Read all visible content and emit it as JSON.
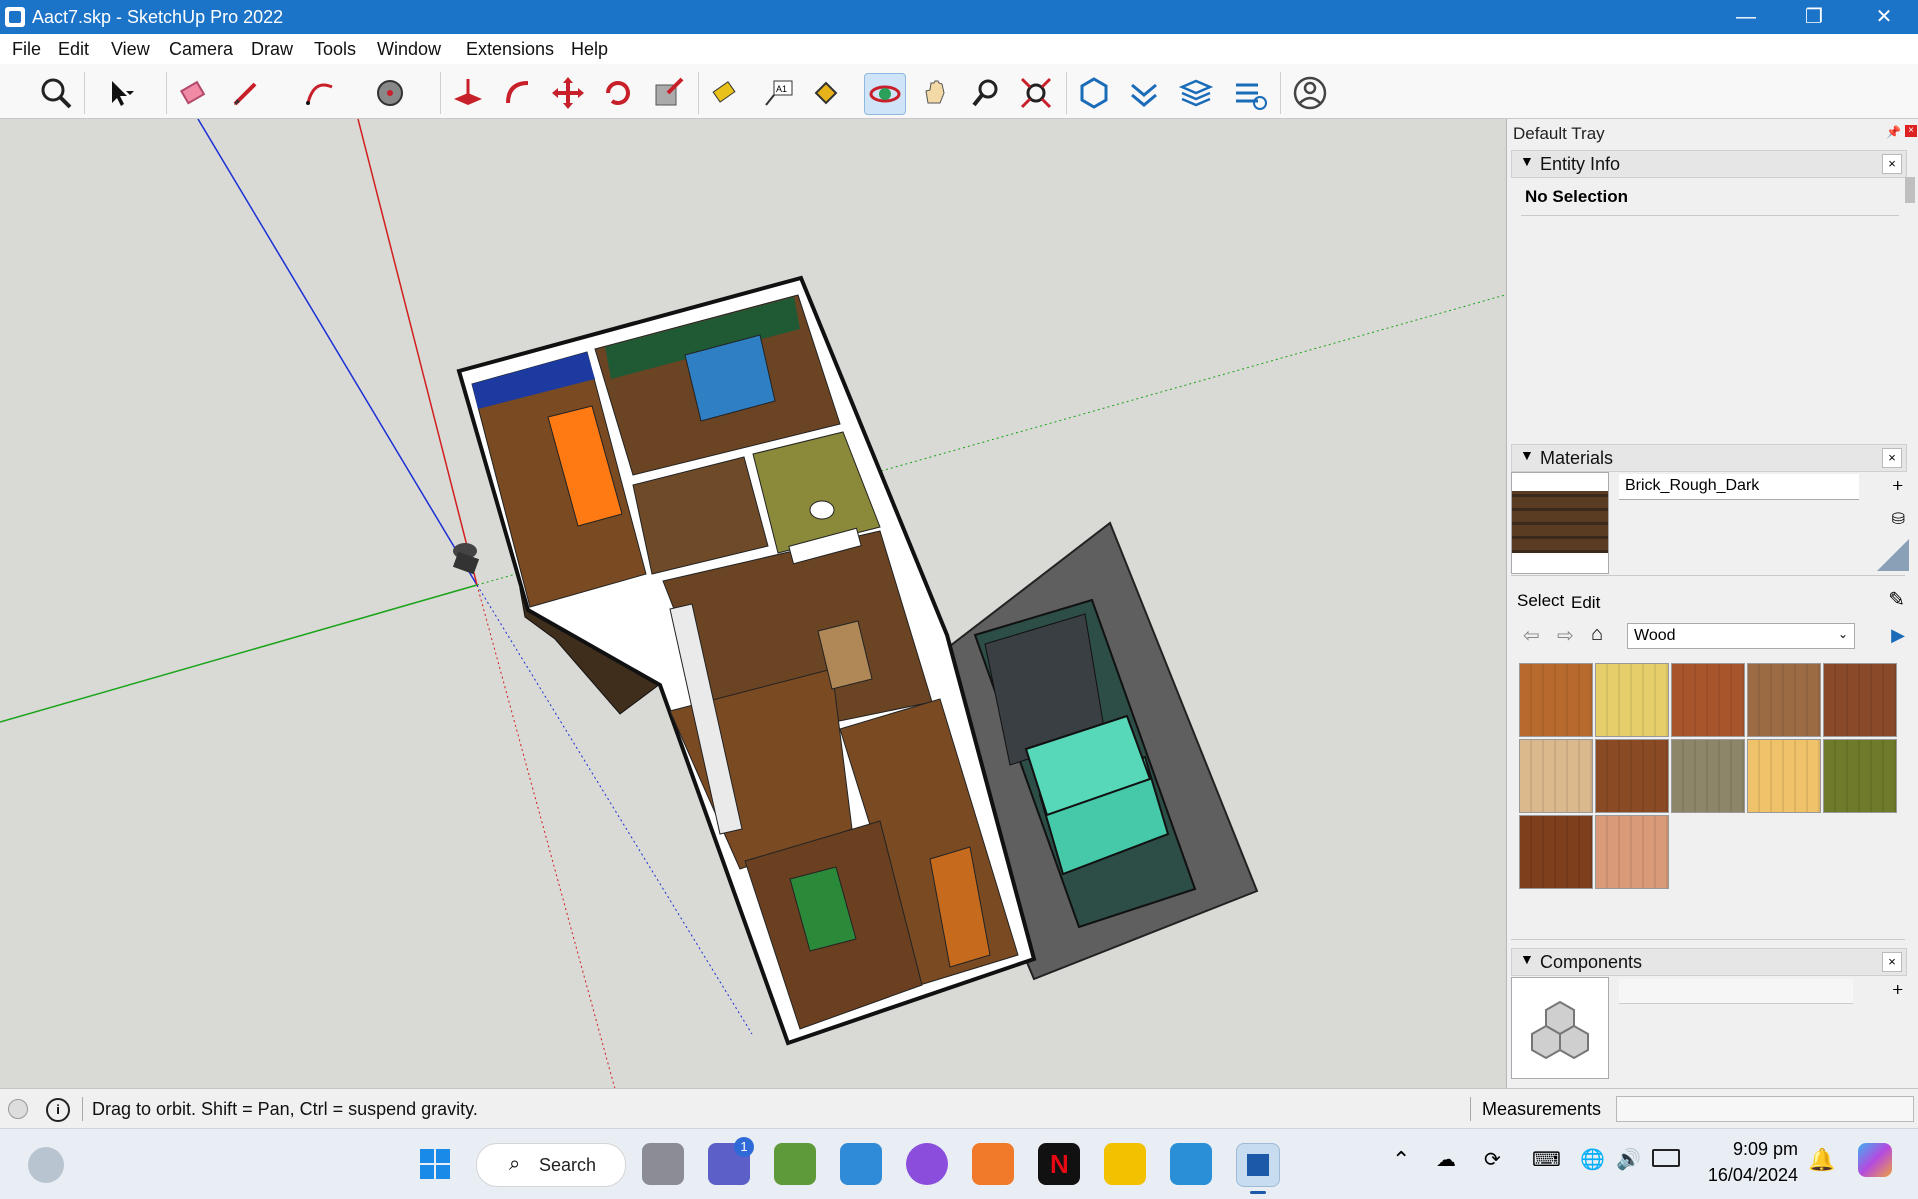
{
  "window": {
    "title": "Aact7.skp - SketchUp Pro 2022",
    "minimize": "—",
    "maximize": "❐",
    "close": "✕"
  },
  "menu": [
    "File",
    "Edit",
    "View",
    "Camera",
    "Draw",
    "Tools",
    "Window",
    "Extensions",
    "Help"
  ],
  "toolbar": {
    "tools": [
      "zoom-extents-icon",
      "select-icon",
      "eraser-icon",
      "pencil-icon",
      "arc-icon",
      "paint-icon",
      "push-pull-icon",
      "follow-me-icon",
      "move-icon",
      "rotate-icon",
      "scale-icon",
      "tape-measure-icon",
      "text-icon",
      "paint-bucket-icon",
      "orbit-icon",
      "pan-icon",
      "zoom-icon",
      "zoom-window-icon",
      "warehouse-icon",
      "extension-warehouse-icon",
      "layers-icon",
      "sandbox-icon",
      "account-icon"
    ],
    "active": "orbit-icon"
  },
  "tray": {
    "title": "Default Tray",
    "entity_info": {
      "header": "Entity Info",
      "status": "No Selection"
    },
    "materials": {
      "header": "Materials",
      "current_name": "Brick_Rough_Dark",
      "tabs": [
        "Select",
        "Edit"
      ],
      "collection": "Wood",
      "swatch_colors": [
        "#b86a2e",
        "#e6cf6a",
        "#a8552b",
        "#9b6b44",
        "#8a4a2a",
        "#dcb98c",
        "#8a4b24",
        "#8d8668",
        "#f0c26a",
        "#6f7a2a",
        "#7d3f1c",
        "#d89a78"
      ]
    },
    "components": {
      "header": "Components"
    }
  },
  "status": {
    "message": "Drag to orbit. Shift = Pan, Ctrl = suspend gravity.",
    "measurements_label": "Measurements",
    "measurements_value": ""
  },
  "taskbar": {
    "search_label": "Search",
    "teams_badge": "1",
    "time": "9:09 pm",
    "date": "16/04/2024"
  },
  "colors": {
    "titlebar": "#1c74c9",
    "accent": "#1c74c9"
  }
}
